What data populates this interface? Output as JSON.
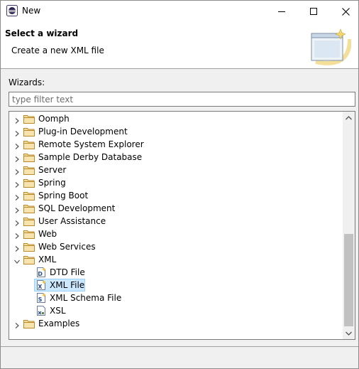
{
  "window": {
    "title": "New"
  },
  "header": {
    "title": "Select a wizard",
    "description": "Create a new XML file"
  },
  "wizards_label": "Wizards:",
  "filter": {
    "placeholder": "type filter text",
    "value": ""
  },
  "tree": {
    "items": [
      {
        "label": "Oomph",
        "kind": "folder",
        "expanded": false
      },
      {
        "label": "Plug-in Development",
        "kind": "folder",
        "expanded": false
      },
      {
        "label": "Remote System Explorer",
        "kind": "folder",
        "expanded": false
      },
      {
        "label": "Sample Derby Database",
        "kind": "folder",
        "expanded": false
      },
      {
        "label": "Server",
        "kind": "folder",
        "expanded": false
      },
      {
        "label": "Spring",
        "kind": "folder",
        "expanded": false
      },
      {
        "label": "Spring Boot",
        "kind": "folder",
        "expanded": false
      },
      {
        "label": "SQL Development",
        "kind": "folder",
        "expanded": false
      },
      {
        "label": "User Assistance",
        "kind": "folder",
        "expanded": false
      },
      {
        "label": "Web",
        "kind": "folder",
        "expanded": false
      },
      {
        "label": "Web Services",
        "kind": "folder",
        "expanded": false
      },
      {
        "label": "XML",
        "kind": "folder",
        "expanded": true
      },
      {
        "label": "DTD File",
        "kind": "file",
        "icon": "dtd-file-icon"
      },
      {
        "label": "XML File",
        "kind": "file",
        "icon": "xml-file-icon",
        "selected": true
      },
      {
        "label": "XML Schema File",
        "kind": "file",
        "icon": "xml-schema-file-icon"
      },
      {
        "label": "XSL",
        "kind": "file",
        "icon": "xsl-file-icon"
      },
      {
        "label": "Examples",
        "kind": "folder",
        "expanded": false
      }
    ]
  },
  "colors": {
    "selection": "#cce8ff",
    "folder": "#dcb567",
    "banner_accent": "#f5d76e"
  }
}
